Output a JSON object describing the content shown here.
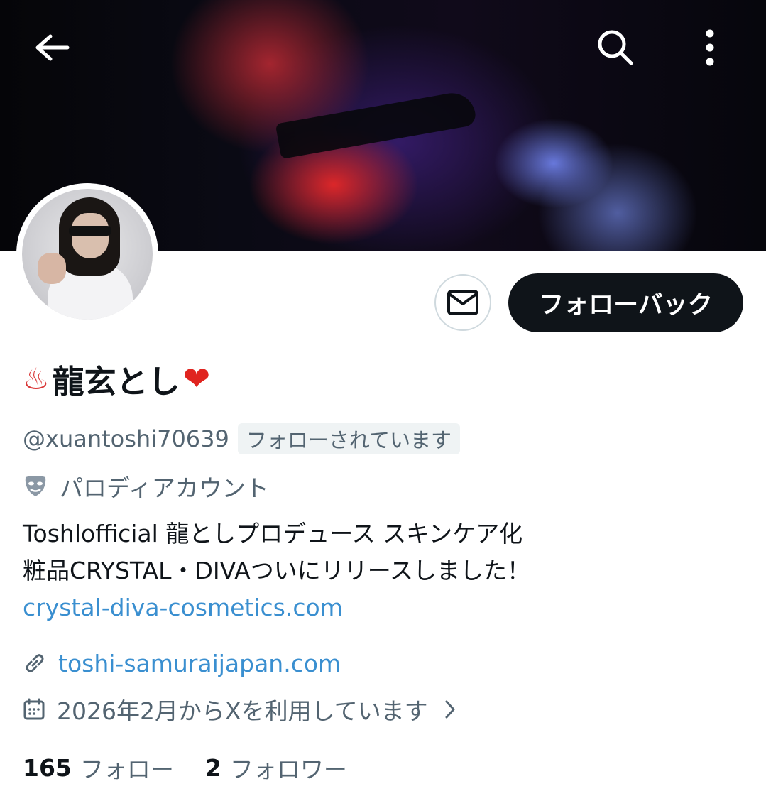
{
  "header": {
    "back_icon": "arrow-left-icon",
    "search_icon": "search-icon",
    "more_icon": "more-vertical-icon"
  },
  "profile": {
    "name_emoji_left": "♨",
    "display_name": "龍玄とし",
    "name_emoji_right": "❤",
    "handle": "@xuantoshi70639",
    "follows_you_badge": "フォローされています",
    "parody_label": "パロディアカウント",
    "bio_line1": "Toshlofficial 龍としプロデュース スキンケア化",
    "bio_line2": "粧品CRYSTAL・DIVAついにリリースしました！",
    "bio_link": "crystal-diva-cosmetics.com",
    "website": "toshi-samuraijapan.com",
    "joined": "2026年2月からXを利用しています",
    "following_count": "165",
    "following_label": "フォロー",
    "followers_count": "2",
    "followers_label": "フォロワー"
  },
  "actions": {
    "message_icon": "envelope-icon",
    "follow_back_label": "フォローバック"
  },
  "colors": {
    "link": "#3a8fd0",
    "secondary_text": "#536471",
    "primary_text": "#0f1419",
    "button_dark": "#0f1419"
  }
}
